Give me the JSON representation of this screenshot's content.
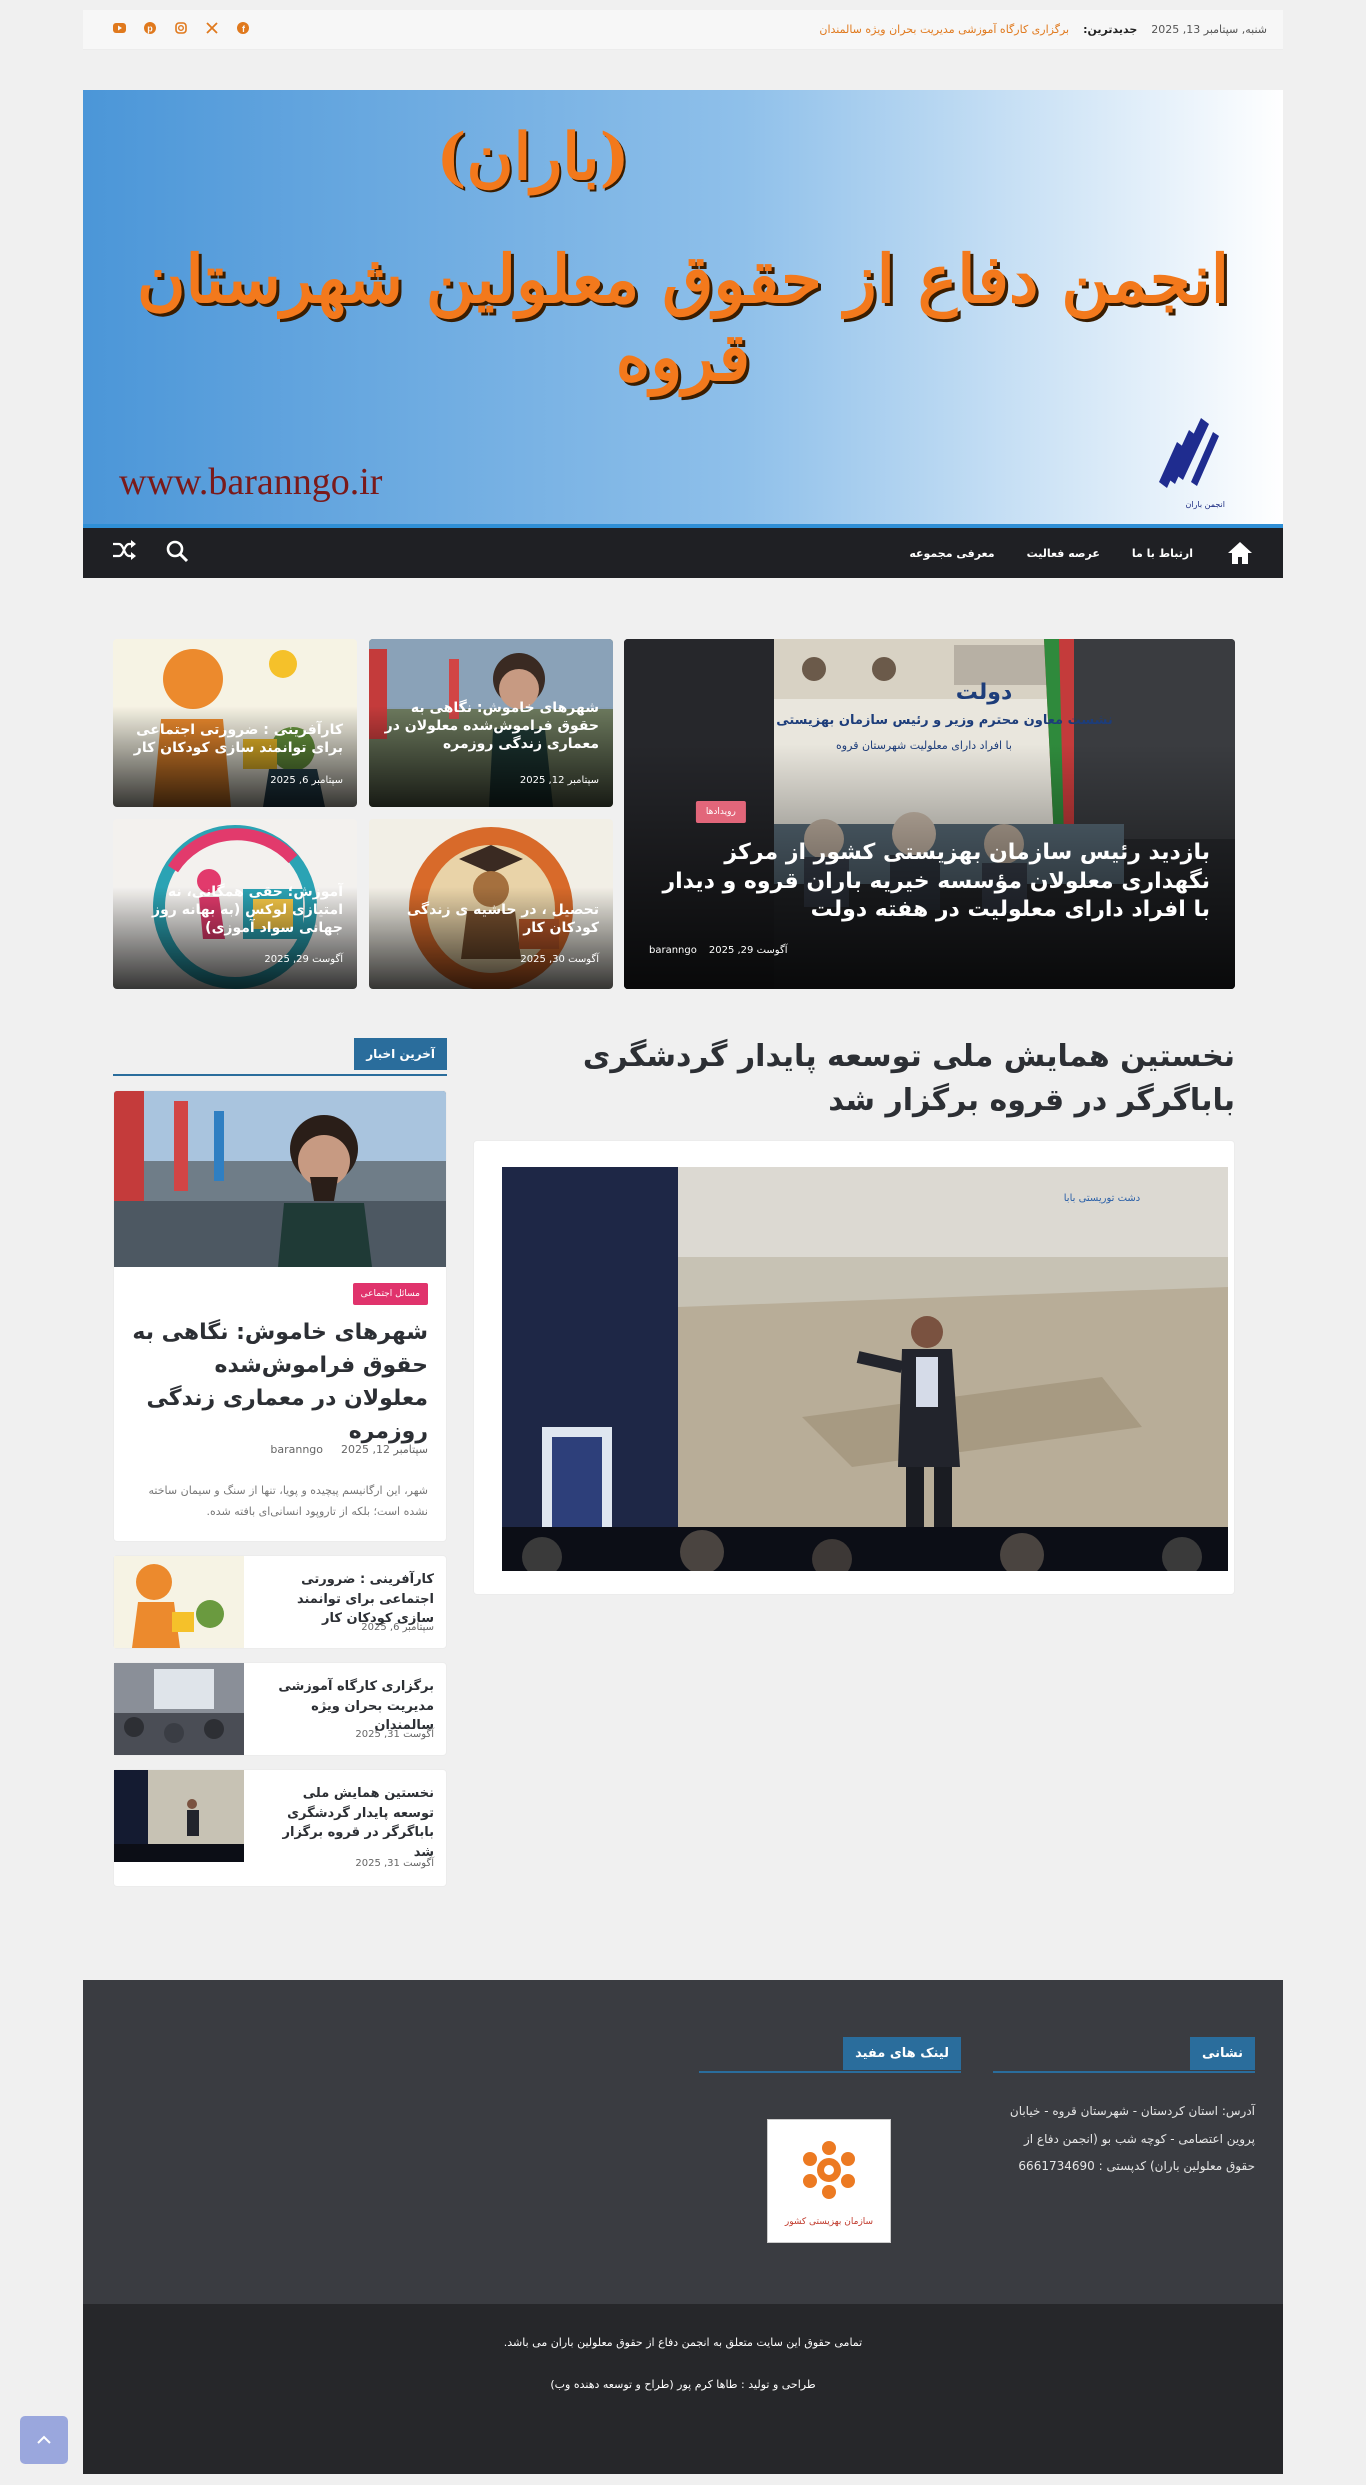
{
  "topbar": {
    "date": "شنبه, سپتامبر 13, 2025",
    "ticker_label": "جدیدترین:",
    "ticker_text": "برگزاری کارگاه آموزشی مدیریت بحران ویژه سالمندان",
    "social": [
      "facebook-icon",
      "x-icon",
      "instagram-icon",
      "pinterest-icon",
      "youtube-icon"
    ]
  },
  "banner": {
    "bracket_text": "(باران)",
    "title": "انجمن دفاع از حقوق معلولین شهرستان قروه",
    "url": "www.baranngo.ir",
    "logo_caption": "انجمن باران"
  },
  "nav": {
    "items": [
      "ارتباط با ما",
      "عرصه فعالیت",
      "معرفی مجموعه"
    ]
  },
  "hero": {
    "main": {
      "badge": "رویدادها",
      "title": "بازدید رئیس سازمان بهزیستی کشور از مرکز نگهداری معلولان مؤسسه خیریه باران قروه و دیدار با افراد دارای معلولیت در هفته دولت",
      "author": "baranngo",
      "date": "آگوست 29, 2025",
      "poster_title": "نشست معاون محترم وزیر و رئیس سازمان بهزیستی کشور",
      "poster_sub": "با افراد دارای معلولیت شهرستان قروه",
      "poster_brand": "دولت"
    },
    "cards": [
      {
        "title": "شهرهای خاموش: نگاهی به حقوق فراموش‌شده معلولان در معماری زندگی روزمره",
        "date": "سپتامبر 12, 2025"
      },
      {
        "title": "کارآفرینی : ضرورتی اجتماعی برای توانمند سازی کودکان کار",
        "date": "سپتامبر 6, 2025"
      },
      {
        "title": "تحصیل ، در حاشیه ی زندگی کودکان کار",
        "date": "آگوست 30, 2025"
      },
      {
        "title": "آموزش؛ حقی همگانی، نه امتیازی لوکس (به بهانه روز جهانی سواد آموزی)",
        "date": "آگوست 29, 2025"
      }
    ]
  },
  "article": {
    "title": "نخستین همایش ملی توسعه پایدار گردشگری باباگرگر در قروه برگزار شد",
    "slide_caption": "دشت توریستی بابا"
  },
  "sidebar": {
    "title": "آخرین اخبار",
    "feature": {
      "badge": "مسائل اجتماعی",
      "title": "شهرهای خاموش: نگاهی به حقوق فراموش‌شده معلولان در معماری زندگی روزمره",
      "date": "سپتامبر 12, 2025",
      "author": "baranngo",
      "excerpt": "شهر، این ارگانیسم پیچیده و پویا، تنها از سنگ و سیمان ساخته نشده است؛ بلکه از تاروپود انسانی‌ای بافته شده."
    },
    "items": [
      {
        "title": "کارآفرینی : ضرورتی اجتماعی برای توانمند سازی کودکان کار",
        "date": "سپتامبر 6, 2025"
      },
      {
        "title": "برگزاری کارگاه آموزشی مدیریت بحران ویژه سالمندان",
        "date": "آگوست 31, 2025"
      },
      {
        "title": "نخستین همایش ملی توسعه پایدار گردشگری باباگرگر در قروه برگزار شد",
        "date": "آگوست 31, 2025"
      }
    ]
  },
  "footer": {
    "address_title": "نشانی",
    "address_text": "آدرس: استان کردستان - شهرستان قروه - خیابان پروین اعتصامی - کوچه شب بو (انجمن دفاع از حقوق معلولین باران) کدپستی : 6661734690",
    "links_title": "لینک های مفید",
    "links_logo_text": "سازمان بهزیستی کشور",
    "copyright": "تمامی حقوق این سایت متعلق به انجمن دفاع از حقوق معلولین باران می باشد.",
    "credit": "طراحی و تولید : طاها کرم پور (طراح و توسعه دهنده وب)"
  }
}
